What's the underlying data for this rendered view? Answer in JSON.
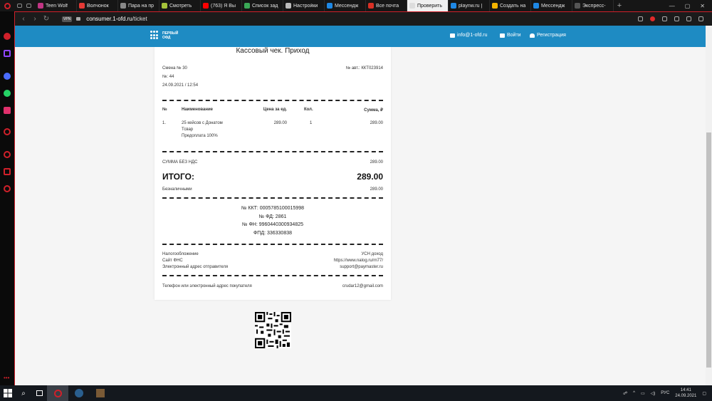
{
  "browser": {
    "tabs": [
      {
        "label": "Teen Wolf",
        "color": "#c13584"
      },
      {
        "label": "Волчонок",
        "color": "#e53935"
      },
      {
        "label": "Пара на пр",
        "color": "#888888"
      },
      {
        "label": "Смотреть",
        "color": "#a5c23a"
      },
      {
        "label": "(763) Я Вы",
        "color": "#ff0000"
      },
      {
        "label": "Список зад",
        "color": "#3aa856"
      },
      {
        "label": "Настройки",
        "color": "#bbbbbb"
      },
      {
        "label": "Мессендж",
        "color": "#1e88e5"
      },
      {
        "label": "Все почта",
        "color": "#d93025"
      },
      {
        "label": "Проверить",
        "color": "#dddddd"
      },
      {
        "label": "playnw.ru |",
        "color": "#1e88e5"
      },
      {
        "label": "Создать на",
        "color": "#f4b400"
      },
      {
        "label": "Мессендж",
        "color": "#1e88e5"
      },
      {
        "label": "Экспресс-",
        "color": "#555555"
      }
    ],
    "active_tab_index": 9,
    "vpn_label": "VPN",
    "url_domain": "consumer.1-ofd.ru",
    "url_path": "/ticket"
  },
  "site": {
    "logo_line1": "ПЕРВЫЙ",
    "logo_line2": "ОФД",
    "email": "info@1-ofd.ru",
    "login": "Войти",
    "register": "Регистрация"
  },
  "receipt": {
    "title": "Кассовый чек.  Приход",
    "shift": "Смена № 30",
    "kkt_reg": "№ авт.: ККТ023914",
    "number": "№: 44",
    "datetime": "24.09.2021 / 12:54",
    "columns": {
      "num": "№",
      "name": "Наименование",
      "price": "Цена за ед.",
      "qty": "Кол.",
      "sum": "Сумма, ₽"
    },
    "items": [
      {
        "num": "1.",
        "name": "25 кейсов с Донатом",
        "type": "Тсвар",
        "payment": "Предоплата 100%",
        "price": "289.00",
        "qty": "1",
        "sum": "289.00"
      }
    ],
    "vat_label": "СУММА БЕЗ НДС",
    "vat_value": "289.00",
    "total_label": "ИТОГО:",
    "total_value": "289.00",
    "cashless_label": "Безналичными",
    "cashless_value": "289.00",
    "kkt": "№ ККТ: 0005785100015998",
    "fd": "№ ФД: 2861",
    "fn": "№ ФН: 9960440300934825",
    "fpd": "ФПД: 336330838",
    "tax_label": "Налогообложение",
    "tax_value": "УСН доход",
    "fns_label": "Сайт ФНС",
    "fns_value": "https://www.nalog.ru/rn77/",
    "sender_label": "Электронный адрес отправителя",
    "sender_value": "support@paymaster.ru",
    "buyer_label": "Телефон или электронный адрес покупателя",
    "buyer_value": "crudar12@gmail.com"
  },
  "taskbar": {
    "lang": "РУС",
    "time": "14:41",
    "date": "24.09.2021"
  }
}
